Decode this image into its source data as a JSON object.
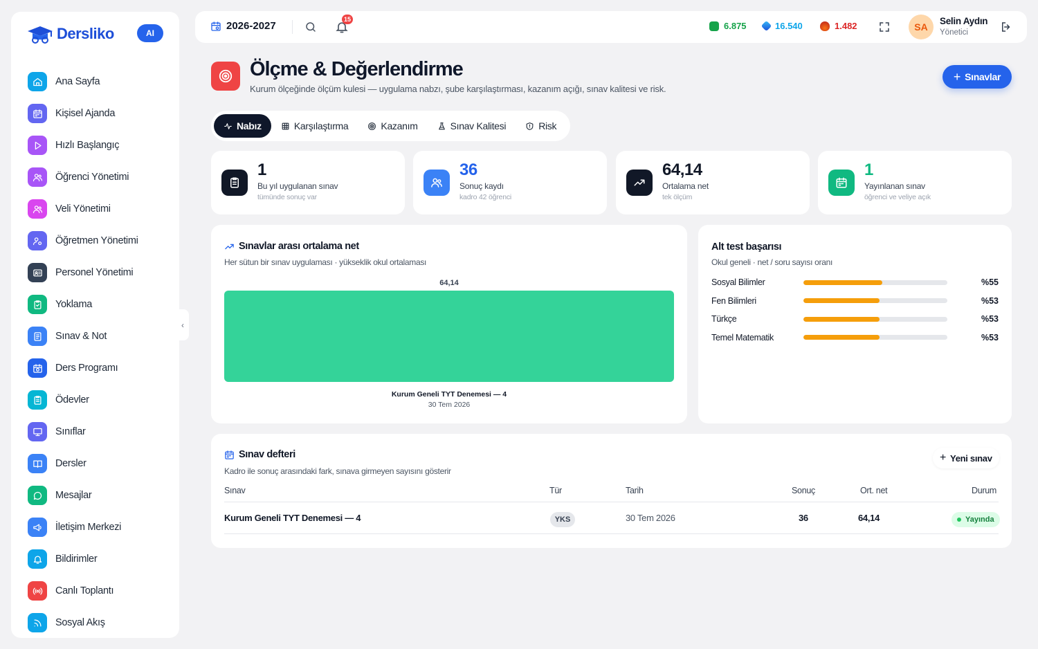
{
  "brand": {
    "name": "Dersliko",
    "ai_badge": "AI"
  },
  "sidebar": {
    "items": [
      {
        "label": "Ana Sayfa",
        "icon": "home-icon",
        "color": "#0ea5e9"
      },
      {
        "label": "Kişisel Ajanda",
        "icon": "calendar-icon",
        "color": "#6366f1"
      },
      {
        "label": "Hızlı Başlangıç",
        "icon": "play-icon",
        "color": "#a855f7"
      },
      {
        "label": "Öğrenci Yönetimi",
        "icon": "users-icon",
        "color": "#a855f7"
      },
      {
        "label": "Veli Yönetimi",
        "icon": "users-icon",
        "color": "#d946ef"
      },
      {
        "label": "Öğretmen Yönetimi",
        "icon": "user-cog-icon",
        "color": "#6366f1"
      },
      {
        "label": "Personel Yönetimi",
        "icon": "id-card-icon",
        "color": "#334155"
      },
      {
        "label": "Yoklama",
        "icon": "clipboard-check-icon",
        "color": "#10b981"
      },
      {
        "label": "Sınav & Not",
        "icon": "document-icon",
        "color": "#3b82f6"
      },
      {
        "label": "Ders Programı",
        "icon": "calendar-clock-icon",
        "color": "#2563eb"
      },
      {
        "label": "Ödevler",
        "icon": "clipboard-icon",
        "color": "#06b6d4"
      },
      {
        "label": "Sınıflar",
        "icon": "presentation-icon",
        "color": "#6366f1"
      },
      {
        "label": "Dersler",
        "icon": "book-icon",
        "color": "#3b82f6"
      },
      {
        "label": "Mesajlar",
        "icon": "chat-icon",
        "color": "#10b981"
      },
      {
        "label": "İletişim Merkezi",
        "icon": "megaphone-icon",
        "color": "#3b82f6"
      },
      {
        "label": "Bildirimler",
        "icon": "bell-icon",
        "color": "#0ea5e9"
      },
      {
        "label": "Canlı Toplantı",
        "icon": "broadcast-icon",
        "color": "#ef4444"
      },
      {
        "label": "Sosyal Akış",
        "icon": "rss-icon",
        "color": "#0ea5e9"
      }
    ]
  },
  "topbar": {
    "year": "2026-2027",
    "notification_count": "15",
    "stats": [
      {
        "value": "6.875",
        "color": "#16a34a",
        "icon": "coin-icon"
      },
      {
        "value": "16.540",
        "color": "#0ea5e9",
        "icon": "gem-icon"
      },
      {
        "value": "1.482",
        "color": "#dc2626",
        "icon": "flame-icon"
      }
    ],
    "user": {
      "initials": "SA",
      "name": "Selin Aydın",
      "role": "Yönetici"
    }
  },
  "header": {
    "title": "Ölçme & Değerlendirme",
    "subtitle": "Kurum ölçeğinde ölçüm kulesi — uygulama nabzı, şube karşılaştırması, kazanım açığı, sınav kalitesi ve risk.",
    "primary_button": "Sınavlar"
  },
  "tabs": [
    {
      "label": "Nabız",
      "icon": "pulse-icon",
      "active": true
    },
    {
      "label": "Karşılaştırma",
      "icon": "grid-icon",
      "active": false
    },
    {
      "label": "Kazanım",
      "icon": "target-icon",
      "active": false
    },
    {
      "label": "Sınav Kalitesi",
      "icon": "flask-icon",
      "active": false
    },
    {
      "label": "Risk",
      "icon": "shield-icon",
      "active": false
    }
  ],
  "stat_cards": [
    {
      "value": "1",
      "label": "Bu yıl uygulanan sınav",
      "note": "tümünde sonuç var",
      "value_color": "#111827",
      "icon_bg": "#111827",
      "icon": "clipboard-icon"
    },
    {
      "value": "36",
      "label": "Sonuç kaydı",
      "note": "kadro 42 öğrenci",
      "value_color": "#2563eb",
      "icon_bg": "#3b82f6",
      "icon": "users-icon"
    },
    {
      "value": "64,14",
      "label": "Ortalama net",
      "note": "tek ölçüm",
      "value_color": "#111827",
      "icon_bg": "#111827",
      "icon": "trend-up-icon"
    },
    {
      "value": "1",
      "label": "Yayınlanan sınav",
      "note": "öğrenci ve veliye açık",
      "value_color": "#10b981",
      "icon_bg": "#10b981",
      "icon": "calendar-icon"
    }
  ],
  "chart_card": {
    "title": "Sınavlar arası ortalama net",
    "subtitle": "Her sütun bir sınav uygulaması · yükseklik okul ortalaması"
  },
  "chart_data": {
    "type": "bar",
    "categories": [
      "Kurum Geneli TYT Denemesi — 4"
    ],
    "category_dates": [
      "30 Tem 2026"
    ],
    "values": [
      64.14
    ],
    "value_labels": [
      "64,14"
    ],
    "color": "#34d399"
  },
  "alt_test": {
    "title": "Alt test başarısı",
    "subtitle": "Okul geneli · net / soru sayısı oranı",
    "rows": [
      {
        "name": "Sosyal Bilimler",
        "value": 55,
        "label": "%55"
      },
      {
        "name": "Fen Bilimleri",
        "value": 53,
        "label": "%53"
      },
      {
        "name": "Türkçe",
        "value": 53,
        "label": "%53"
      },
      {
        "name": "Temel Matematik",
        "value": 53,
        "label": "%53"
      }
    ]
  },
  "exam_table": {
    "title": "Sınav defteri",
    "subtitle": "Kadro ile sonuç arasındaki fark, sınava girmeyen sayısını gösterir",
    "new_button": "Yeni sınav",
    "columns": {
      "name": "Sınav",
      "type": "Tür",
      "date": "Tarih",
      "results": "Sonuç",
      "avg": "Ort. net",
      "status": "Durum"
    },
    "rows": [
      {
        "name": "Kurum Geneli TYT Denemesi — 4",
        "type": "YKS",
        "date": "30 Tem 2026",
        "results": "36",
        "avg": "64,14",
        "status": "Yayında"
      }
    ]
  }
}
